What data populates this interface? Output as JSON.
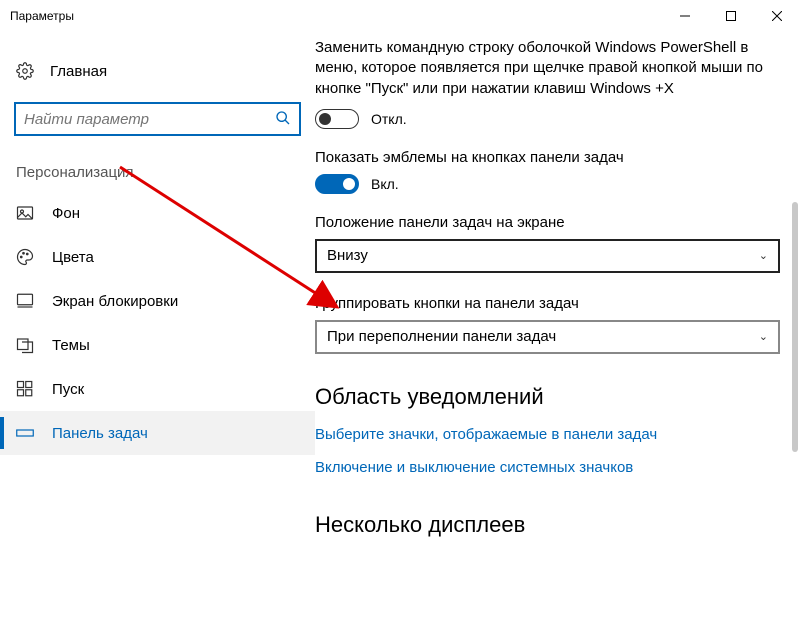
{
  "window": {
    "title": "Параметры"
  },
  "sidebar": {
    "home": "Главная",
    "search_placeholder": "Найти параметр",
    "section": "Персонализация",
    "items": [
      {
        "label": "Фон"
      },
      {
        "label": "Цвета"
      },
      {
        "label": "Экран блокировки"
      },
      {
        "label": "Темы"
      },
      {
        "label": "Пуск"
      },
      {
        "label": "Панель задач"
      }
    ]
  },
  "main": {
    "powershell_desc": "Заменить командную строку оболочкой Windows PowerShell в меню, которое появляется при щелчке правой кнопкой мыши по кнопке \"Пуск\" или при нажатии клавиш Windows +X",
    "off_label": "Откл.",
    "badges_label": "Показать эмблемы на кнопках панели задач",
    "on_label": "Вкл.",
    "position_label": "Положение панели задач на экране",
    "position_value": "Внизу",
    "group_label": "Группировать кнопки на панели задач",
    "group_value": "При переполнении панели задач",
    "notif_heading": "Область уведомлений",
    "link_icons": "Выберите значки, отображаемые в панели задач",
    "link_sysicons": "Включение и выключение системных значков",
    "multi_heading": "Несколько дисплеев"
  }
}
